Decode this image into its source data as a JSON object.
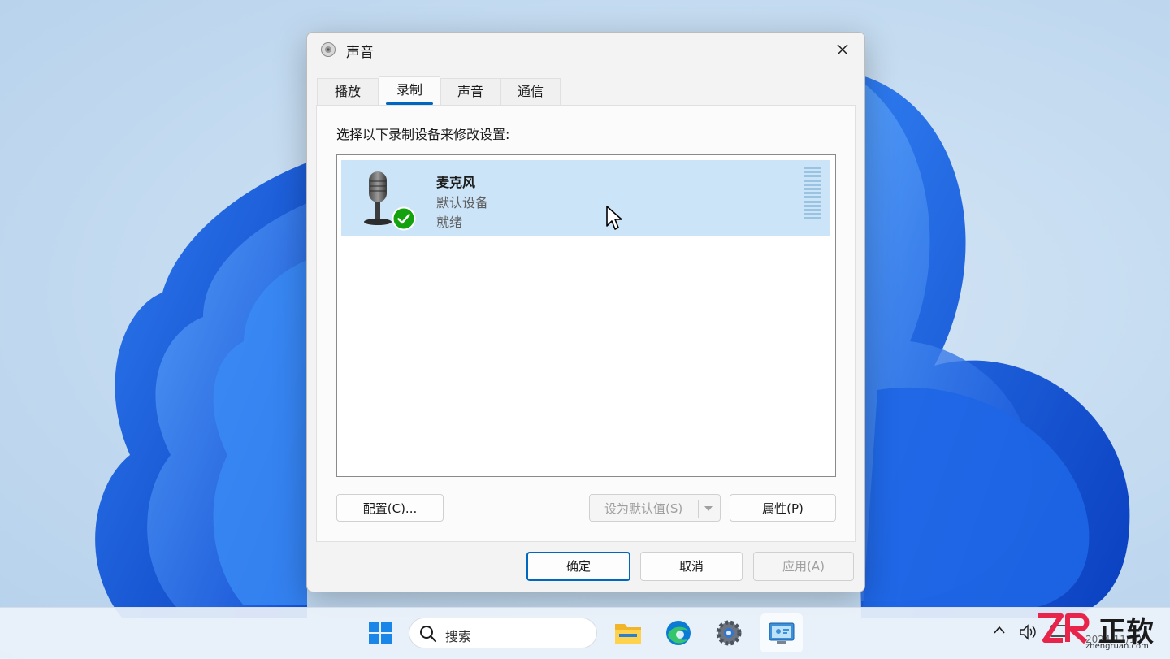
{
  "dialog": {
    "title": "声音",
    "tabs": [
      "播放",
      "录制",
      "声音",
      "通信"
    ],
    "active_tab": "录制",
    "instruction": "选择以下录制设备来修改设置:",
    "device": {
      "name": "麦克风",
      "subtitle": "默认设备",
      "status": "就绪",
      "is_default": true
    },
    "buttons": {
      "configure": "配置(C)...",
      "set_default": "设为默认值(S)",
      "properties": "属性(P)",
      "ok": "确定",
      "cancel": "取消",
      "apply": "应用(A)"
    },
    "colors": {
      "selection": "#cce4f7",
      "accent": "#0067c0",
      "check_badge": "#13a10e"
    }
  },
  "taskbar": {
    "search_placeholder": "搜索",
    "apps": [
      "start-icon",
      "search",
      "file-explorer-icon",
      "edge-icon",
      "settings-icon",
      "control-panel-icon"
    ],
    "tray": [
      "chevron-up-icon",
      "volume-icon",
      "display-icon"
    ],
    "clock_partial": "2024/11/10"
  },
  "watermark": {
    "logo": "ZR",
    "name": "正软",
    "url": "zhengruan.com"
  }
}
